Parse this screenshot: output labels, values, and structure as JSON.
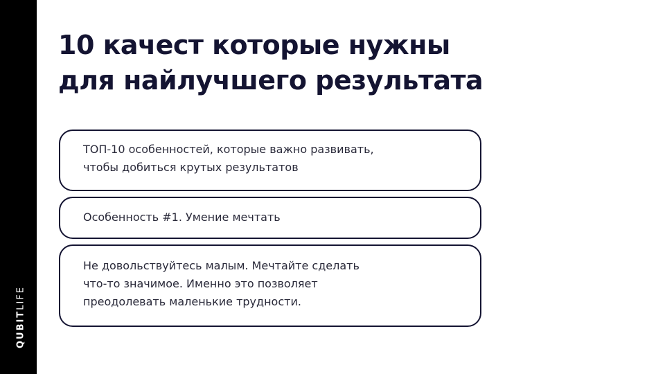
{
  "brand": {
    "bold": "QUBIT",
    "light": "LIFE"
  },
  "title": {
    "line1": "10 качест которые нужны",
    "line2": "для найлучшего результата"
  },
  "cards": [
    {
      "lines": [
        "ТОП-10 особенностей, которые важно развивать,",
        "чтобы добиться крутых результатов"
      ]
    },
    {
      "lines": [
        "Особенность #1. Умение мечтать"
      ]
    },
    {
      "lines": [
        "Не довольствуйтесь малым. Мечтайте сделать",
        "что-то значимое. Именно это позволяет",
        "преодолевать маленькие трудности."
      ]
    }
  ],
  "colors": {
    "sidebar": "#000000",
    "title": "#141432",
    "border": "#141432",
    "body_text": "#2a2a3a",
    "background": "#ffffff"
  }
}
